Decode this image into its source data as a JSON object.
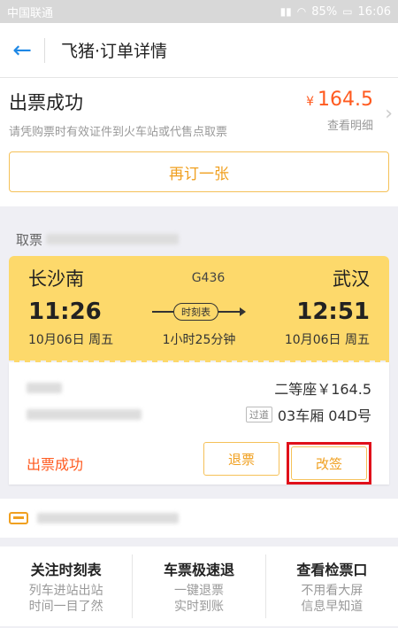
{
  "status_bar": {
    "carrier": "中国联通",
    "battery": "85%",
    "time": "16:06"
  },
  "nav": {
    "title": "飞猪·订单详情"
  },
  "summary": {
    "status_title": "出票成功",
    "status_sub": "请凭购票时有效证件到火车站或代售点取票",
    "price_symbol": "¥",
    "price": "164.5",
    "detail_link": "查看明细",
    "rebook_label": "再订一张"
  },
  "pickup": {
    "label": "取票"
  },
  "ticket": {
    "from_station": "长沙南",
    "to_station": "武汉",
    "train_no": "G436",
    "depart_time": "11:26",
    "arrive_time": "12:51",
    "schedule_label": "时刻表",
    "depart_date": "10月06日 周五",
    "arrive_date": "10月06日 周五",
    "duration": "1小时25分钟"
  },
  "passenger": {
    "seat_price": "二等座￥164.5",
    "gate_badge": "过道",
    "car_seat": "03车厢 04D号",
    "ticket_status": "出票成功",
    "refund_label": "退票",
    "change_label": "改签"
  },
  "features": [
    {
      "title": "关注时刻表",
      "sub1": "列车进站出站",
      "sub2": "时间一目了然"
    },
    {
      "title": "车票极速退",
      "sub1": "一键退票",
      "sub2": "实时到账"
    },
    {
      "title": "查看检票口",
      "sub1": "不用看大屏",
      "sub2": "信息早知道"
    }
  ],
  "colors": {
    "accent": "#f0a020",
    "price": "#ff5a1f",
    "ticket_bg": "#fdd96b",
    "highlight": "#e0101a"
  }
}
